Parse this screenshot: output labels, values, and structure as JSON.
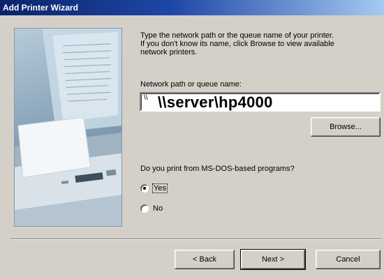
{
  "window": {
    "title": "Add Printer Wizard"
  },
  "content": {
    "prompt_text": "Type the network path or the queue name of your printer.\nIf you don't know its name, click Browse to view available\nnetwork printers.",
    "path_label": "Network path or queue name:",
    "path_value": "\\\\server\\hp4000",
    "path_small_glyph": "\\\\",
    "browse_label": "Browse...",
    "dos_question": "Do you print from MS-DOS-based programs?",
    "options": [
      {
        "label": "Yes",
        "selected": true
      },
      {
        "label": "No",
        "selected": false
      }
    ]
  },
  "buttons": {
    "back": "< Back",
    "next": "Next >",
    "cancel": "Cancel"
  },
  "colors": {
    "dialog_face": "#d4d0c8",
    "title_gradient_start": "#0a246a",
    "title_gradient_end": "#a6caf0"
  }
}
